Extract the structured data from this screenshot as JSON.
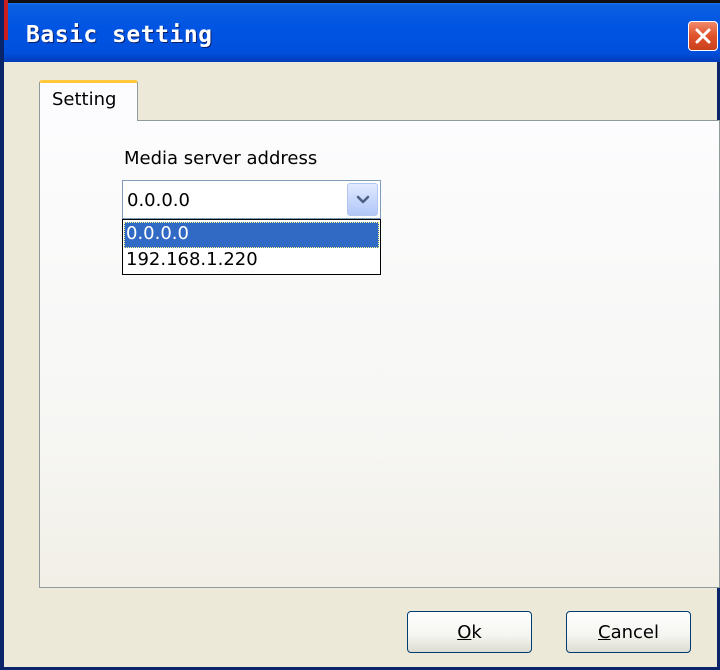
{
  "window": {
    "title": "Basic setting",
    "close_icon": "close-icon"
  },
  "tabs": [
    {
      "label": "Setting",
      "active": true
    }
  ],
  "media_server": {
    "label": "Media server address",
    "selected_value": "0.0.0.0",
    "options": [
      "0.0.0.0",
      "192.168.1.220"
    ],
    "highlighted_option": "0.0.0.0",
    "arrow_icon": "chevron-down-icon"
  },
  "buttons": {
    "ok_mnemonic": "O",
    "ok_rest": "k",
    "cancel_mnemonic": "C",
    "cancel_rest": "ancel"
  },
  "colors": {
    "titlebar": "#0054e3",
    "selection": "#316ac5",
    "tab_accent": "#ffc83c",
    "close_button": "#e0522a"
  }
}
